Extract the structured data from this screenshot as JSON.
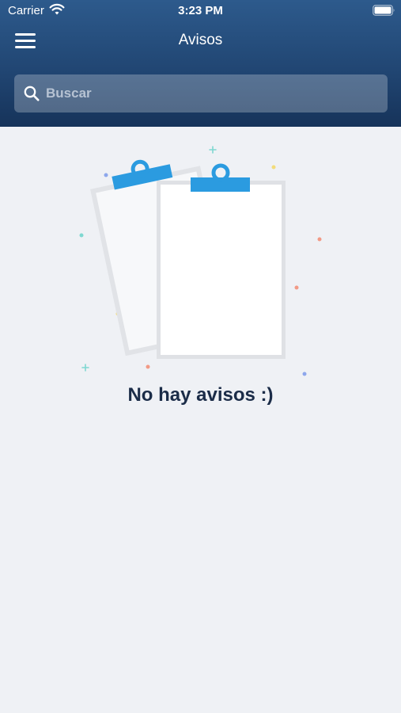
{
  "status_bar": {
    "carrier": "Carrier",
    "time": "3:23 PM",
    "icons": [
      "wifi-icon",
      "battery-icon"
    ]
  },
  "header": {
    "title": "Avisos",
    "menu_icon": "hamburger-menu-icon",
    "gradient_colors": [
      "#2d5a8c",
      "#16335a"
    ]
  },
  "search": {
    "placeholder": "Buscar",
    "value": "",
    "icon": "search-icon"
  },
  "empty_state": {
    "illustration": "clipboards-illustration",
    "message": "No hay avisos :)",
    "accent_color": "#2b9be0"
  }
}
